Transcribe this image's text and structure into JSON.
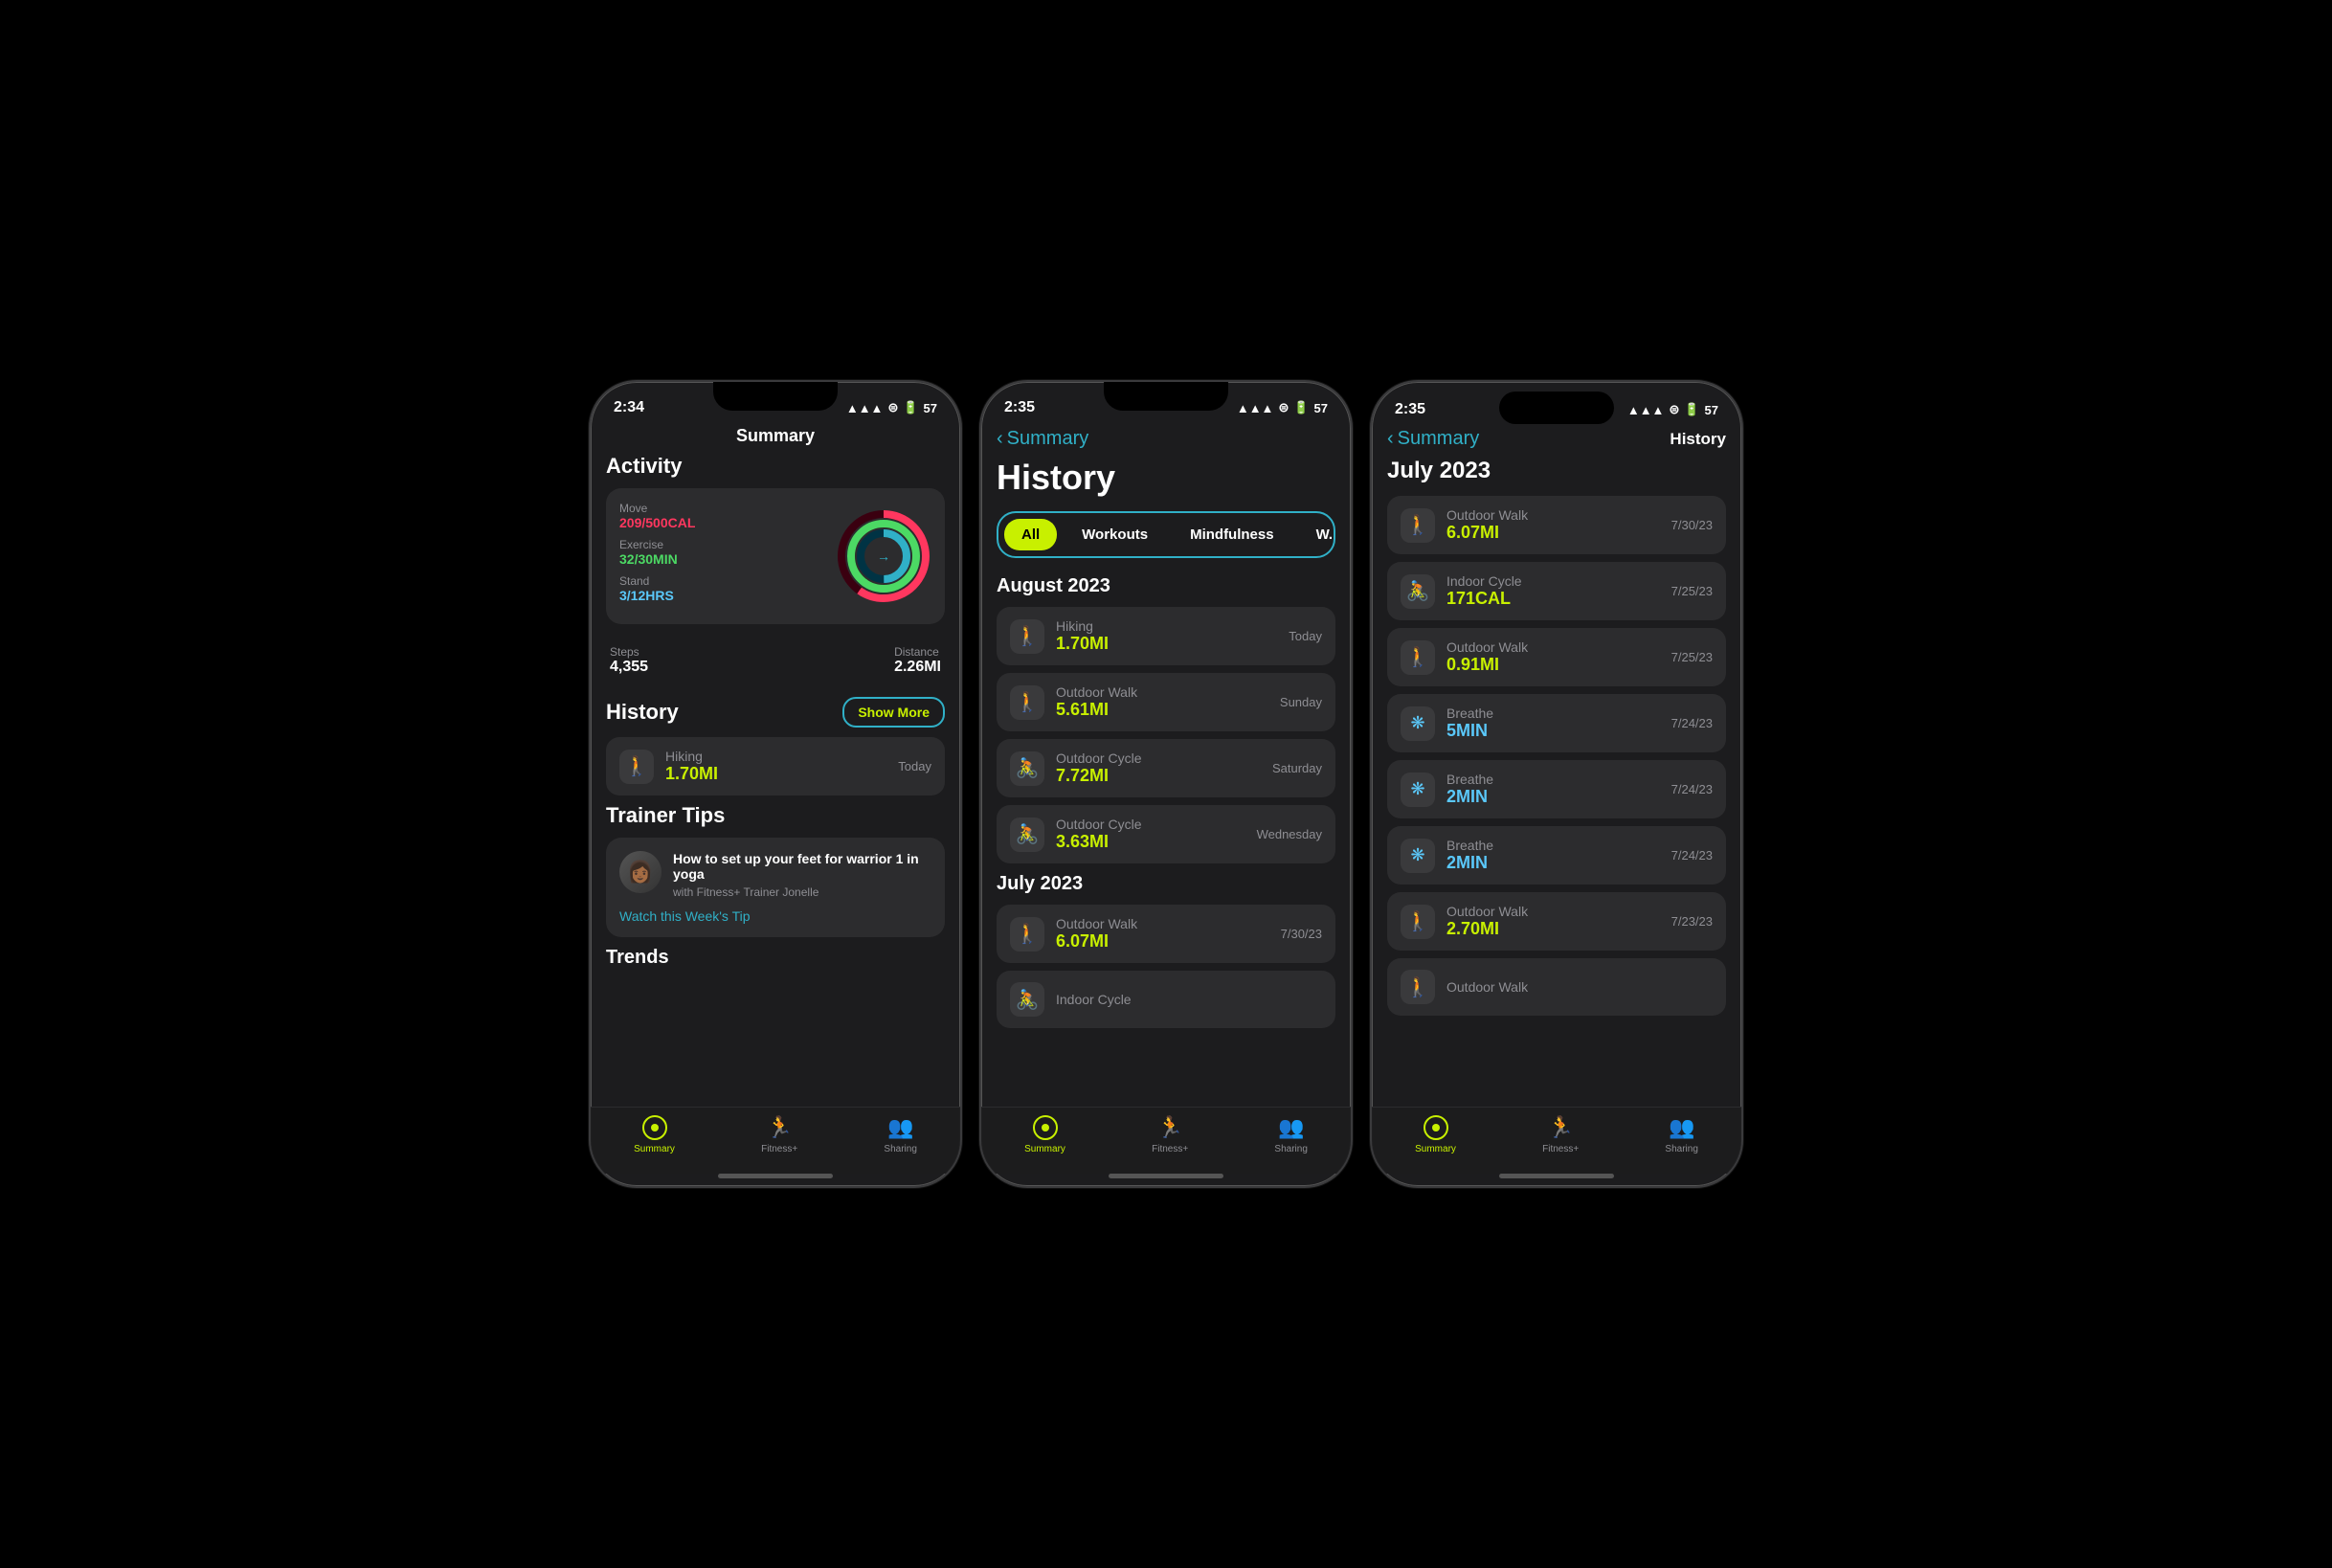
{
  "phone1": {
    "status": {
      "time": "2:34",
      "signal": "▲▲▲",
      "wifi": "wifi",
      "battery": "57"
    },
    "header": "Summary",
    "activity": {
      "title": "Activity",
      "move_label": "Move",
      "move_value": "209/500CAL",
      "exercise_label": "Exercise",
      "exercise_value": "32/30MIN",
      "stand_label": "Stand",
      "stand_value": "3/12HRS",
      "steps_label": "Steps",
      "steps_value": "4,355",
      "distance_label": "Distance",
      "distance_value": "2.26MI"
    },
    "history": {
      "title": "History",
      "show_more": "Show More",
      "items": [
        {
          "icon": "🚶",
          "name": "Hiking",
          "value": "1.70MI",
          "date": "Today"
        }
      ]
    },
    "trainer_tips": {
      "title": "Trainer Tips",
      "tip": "How to set up your feet for warrior 1 in yoga",
      "subtitle": "with Fitness+ Trainer Jonelle",
      "watch_label": "Watch this Week's Tip"
    },
    "trends": {
      "title": "Trends"
    },
    "tabs": [
      {
        "label": "Summary",
        "active": true
      },
      {
        "label": "Fitness+",
        "active": false
      },
      {
        "label": "Sharing",
        "active": false
      }
    ]
  },
  "phone2": {
    "status": {
      "time": "2:35",
      "battery": "57"
    },
    "nav_back": "Summary",
    "page_title": "History",
    "filters": [
      {
        "label": "All",
        "active": true
      },
      {
        "label": "Workouts",
        "active": false
      },
      {
        "label": "Mindfulness",
        "active": false
      },
      {
        "label": "W...",
        "active": false
      }
    ],
    "months": [
      {
        "name": "August 2023",
        "items": [
          {
            "icon": "walk",
            "name": "Hiking",
            "value": "1.70MI",
            "date": "Today"
          },
          {
            "icon": "walk",
            "name": "Outdoor Walk",
            "value": "5.61MI",
            "date": "Sunday"
          },
          {
            "icon": "cycle",
            "name": "Outdoor Cycle",
            "value": "7.72MI",
            "date": "Saturday"
          },
          {
            "icon": "cycle",
            "name": "Outdoor Cycle",
            "value": "3.63MI",
            "date": "Wednesday"
          }
        ]
      },
      {
        "name": "July 2023",
        "items": [
          {
            "icon": "walk",
            "name": "Outdoor Walk",
            "value": "6.07MI",
            "date": "7/30/23"
          },
          {
            "icon": "cycle",
            "name": "Indoor Cycle",
            "value": "",
            "date": ""
          }
        ]
      }
    ],
    "tabs": [
      {
        "label": "Summary",
        "active": true
      },
      {
        "label": "Fitness+",
        "active": false
      },
      {
        "label": "Sharing",
        "active": false
      }
    ]
  },
  "phone3": {
    "status": {
      "time": "2:35",
      "battery": "57"
    },
    "nav_back": "Summary",
    "page_title": "History",
    "month_title": "July 2023",
    "items": [
      {
        "icon": "walk",
        "name": "Outdoor Walk",
        "value": "6.07MI",
        "date": "7/30/23"
      },
      {
        "icon": "cycle_indoor",
        "name": "Indoor Cycle",
        "value": "171CAL",
        "date": "7/25/23"
      },
      {
        "icon": "walk",
        "name": "Outdoor Walk",
        "value": "0.91MI",
        "date": "7/25/23"
      },
      {
        "icon": "breathe",
        "name": "Breathe",
        "value": "5MIN",
        "date": "7/24/23"
      },
      {
        "icon": "breathe",
        "name": "Breathe",
        "value": "2MIN",
        "date": "7/24/23"
      },
      {
        "icon": "breathe",
        "name": "Breathe",
        "value": "2MIN",
        "date": "7/24/23"
      },
      {
        "icon": "walk",
        "name": "Outdoor Walk",
        "value": "2.70MI",
        "date": "7/23/23"
      },
      {
        "icon": "walk",
        "name": "Outdoor Walk",
        "value": "",
        "date": ""
      }
    ],
    "tabs": [
      {
        "label": "Summary",
        "active": true
      },
      {
        "label": "Fitness+",
        "active": false
      },
      {
        "label": "Sharing",
        "active": false
      }
    ]
  }
}
